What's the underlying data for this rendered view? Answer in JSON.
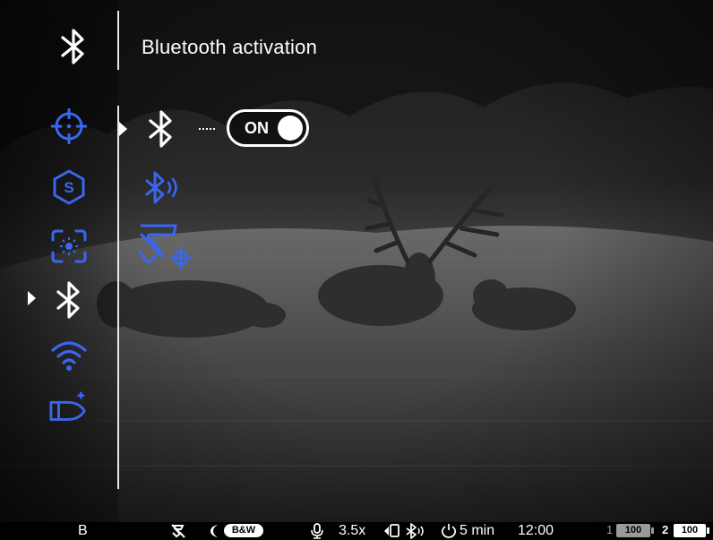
{
  "header": {
    "title": "Bluetooth activation",
    "icon": "bluetooth-icon"
  },
  "colors": {
    "accent": "#3a66f0",
    "text": "#ffffff",
    "toggle_knob": "#ffffff",
    "battery_low": "#9a9a9a"
  },
  "sidebar": {
    "selected_index": 3,
    "items": [
      {
        "icon": "crosshair-icon"
      },
      {
        "icon": "stadiametric-s-icon"
      },
      {
        "icon": "brightness-calibration-icon"
      },
      {
        "icon": "bluetooth-icon"
      },
      {
        "icon": "wifi-icon"
      },
      {
        "icon": "ballistics-bullet-icon"
      }
    ]
  },
  "submenu": {
    "selected_index": 0,
    "items": [
      {
        "icon": "bluetooth-icon",
        "toggle": "ON"
      },
      {
        "icon": "bluetooth-audio-icon"
      },
      {
        "icon": "stream-vision-target-icon"
      }
    ]
  },
  "statusbar": {
    "mode": "B",
    "color_mode": "B&W",
    "zoom": "3.5x",
    "auto_off": "5 min",
    "clock": "12:00",
    "battery1_index": "1",
    "battery1_level": "100",
    "battery2_index": "2",
    "battery2_level": "100"
  }
}
